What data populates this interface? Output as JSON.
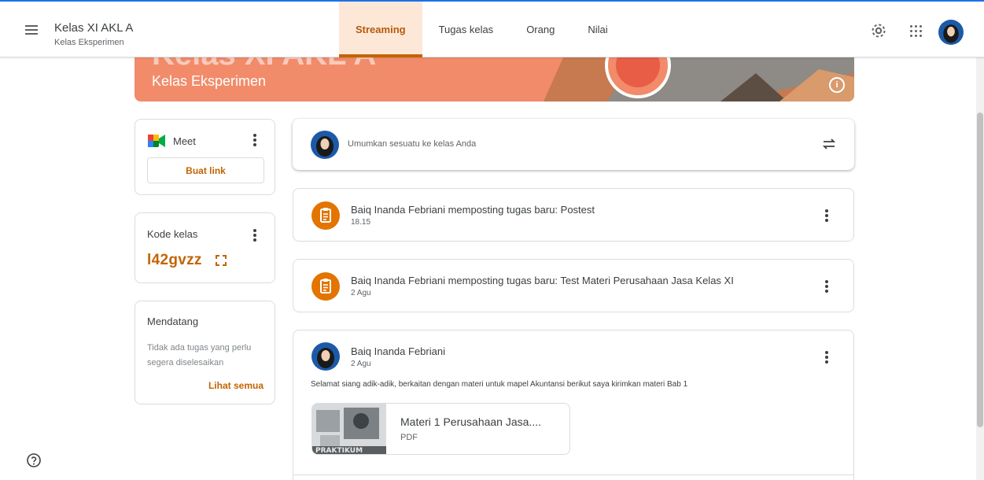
{
  "header": {
    "class_title": "Kelas XI AKL A",
    "class_subtitle": "Kelas Eksperimen",
    "tabs": [
      {
        "label": "Streaming",
        "active": true
      },
      {
        "label": "Tugas kelas",
        "active": false
      },
      {
        "label": "Orang",
        "active": false
      },
      {
        "label": "Nilai",
        "active": false
      }
    ],
    "icons": [
      "menu-icon",
      "gear-icon",
      "apps-grid-icon",
      "user-avatar"
    ]
  },
  "banner": {
    "title": "Kelas XI AKL A",
    "subtitle": "Kelas Eksperimen",
    "color": "#f28b6a"
  },
  "sidebar": {
    "meet": {
      "label": "Meet",
      "button": "Buat link"
    },
    "class_code": {
      "label": "Kode kelas",
      "value": "l42gvzz"
    },
    "upcoming": {
      "title": "Mendatang",
      "empty_text": "Tidak ada tugas yang perlu segera diselesaikan",
      "link": "Lihat semua"
    }
  },
  "stream": {
    "announce_placeholder": "Umumkan sesuatu ke kelas Anda",
    "posts": [
      {
        "title": "Baiq Inanda Febriani memposting tugas baru: Postest",
        "date": "18.15"
      },
      {
        "title": "Baiq Inanda Febriani memposting tugas baru: Test Materi Perusahaan Jasa Kelas XI",
        "date": "2 Agu"
      }
    ],
    "announcement": {
      "author": "Baiq Inanda Febriani",
      "date": "2 Agu",
      "body": "Selamat siang adik-adik, berkaitan dengan materi untuk mapel Akuntansi berikut saya kirimkan materi Bab 1",
      "attachment": {
        "title": "Materi 1 Perusahaan Jasa....",
        "type": "PDF",
        "thumb_text": "PRAKTIKUM"
      }
    }
  },
  "colors": {
    "accent": "#c26401",
    "assignment": "#e37400",
    "top_line": "#1a73e8"
  }
}
